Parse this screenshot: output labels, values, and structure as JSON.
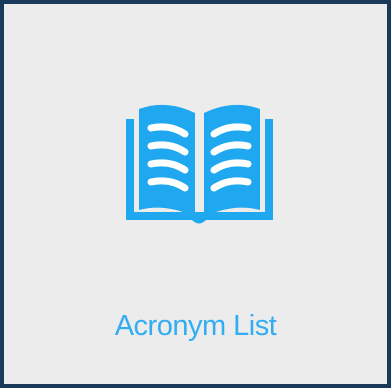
{
  "tile": {
    "label": "Acronym List",
    "icon": "open-book-icon"
  },
  "colors": {
    "accent": "#33adf2",
    "border": "#1a3a5c",
    "background": "#ececec"
  }
}
